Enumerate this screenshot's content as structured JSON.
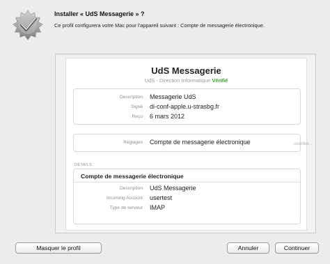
{
  "header": {
    "title": "Installer « UdS Messagerie » ?",
    "message": "Ce profil configurera votre Mac pour l’appareil suivant : Compte de messagerie électronique."
  },
  "profile": {
    "name": "UdS Messagerie",
    "organization": "UdS - Direction Informatique",
    "status": "Vérifié",
    "status_color": "#3f9b2c",
    "summary": [
      {
        "key": "Description",
        "value": "Messagerie UdS"
      },
      {
        "key": "Signé",
        "value": "di-conf-apple.u-strasbg.fr"
      },
      {
        "key": "Reçu",
        "value": "6 mars 2012"
      }
    ],
    "settings": {
      "key": "Réglages",
      "value": "Compte de messagerie électronique",
      "extra": "usertes..."
    },
    "details_label": "DÉTAILS",
    "account": {
      "title": "Compte de messagerie électronique",
      "rows": [
        {
          "key": "Description",
          "value": "UdS Messagerie"
        },
        {
          "key": "Incoming Account",
          "value": "usertest"
        },
        {
          "key": "Type de serveur",
          "value": "IMAP"
        }
      ]
    }
  },
  "buttons": {
    "hide_profile": "Masquer le profil",
    "cancel": "Annuler",
    "continue": "Continuer"
  },
  "icons": {
    "header": "profile-gear-checkmark-icon"
  }
}
